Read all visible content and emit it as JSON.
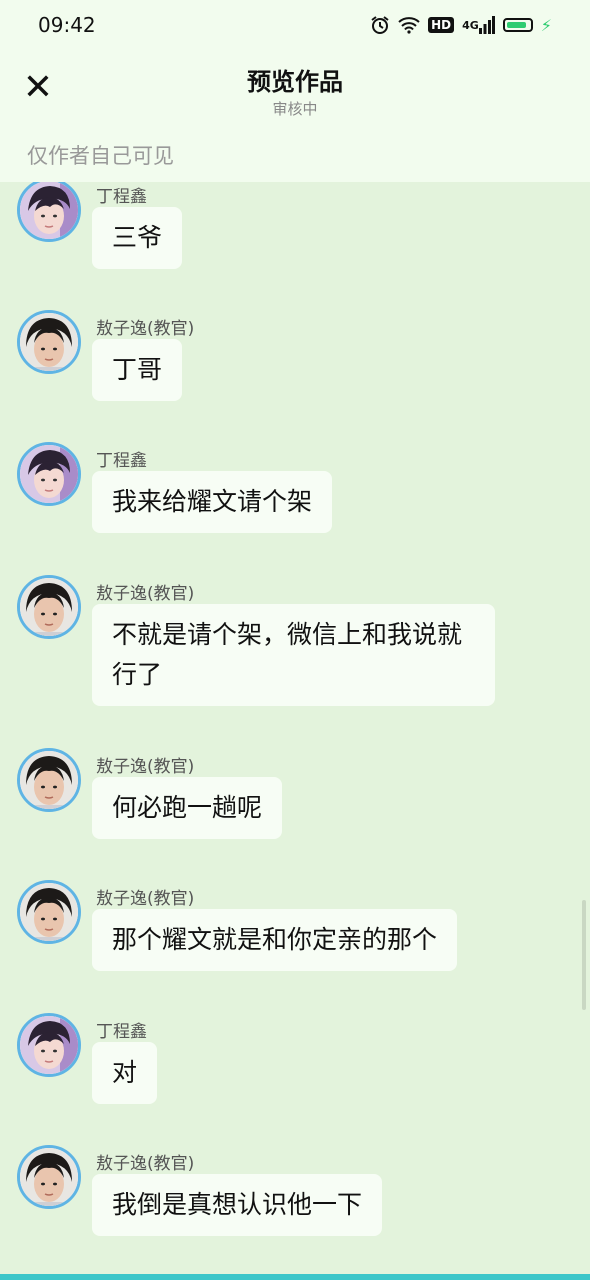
{
  "status_bar": {
    "time": "09:42",
    "icons": [
      "alarm-icon",
      "wifi-icon",
      "hd-icon",
      "4g-signal-icon",
      "battery-icon",
      "charging-icon"
    ],
    "hd_label": "HD",
    "network_label": "4G",
    "battery_level": 0.85
  },
  "header": {
    "close_icon": "close-icon",
    "title": "预览作品",
    "subtitle": "审核中",
    "visibility_note": "仅作者自己可见"
  },
  "messages": [
    {
      "sender": "丁程鑫",
      "avatar": "avatar-ding",
      "text": "三爷"
    },
    {
      "sender": "敖子逸(教官)",
      "avatar": "avatar-ao",
      "text": "丁哥"
    },
    {
      "sender": "丁程鑫",
      "avatar": "avatar-ding",
      "text": "我来给耀文请个架"
    },
    {
      "sender": "敖子逸(教官)",
      "avatar": "avatar-ao",
      "text": "不就是请个架，微信上和我说就行了"
    },
    {
      "sender": "敖子逸(教官)",
      "avatar": "avatar-ao",
      "text": "何必跑一趟呢"
    },
    {
      "sender": "敖子逸(教官)",
      "avatar": "avatar-ao",
      "text": "那个耀文就是和你定亲的那个"
    },
    {
      "sender": "丁程鑫",
      "avatar": "avatar-ding",
      "text": "对"
    },
    {
      "sender": "敖子逸(教官)",
      "avatar": "avatar-ao",
      "text": "我倒是真想认识他一下"
    }
  ],
  "colors": {
    "background": "#e3f3dc",
    "header_bg": "#f2fcee",
    "bubble_bg": "#f7fdf5",
    "avatar_ring": "#5fb4e4",
    "bottom_bar": "#3cc6c9"
  }
}
